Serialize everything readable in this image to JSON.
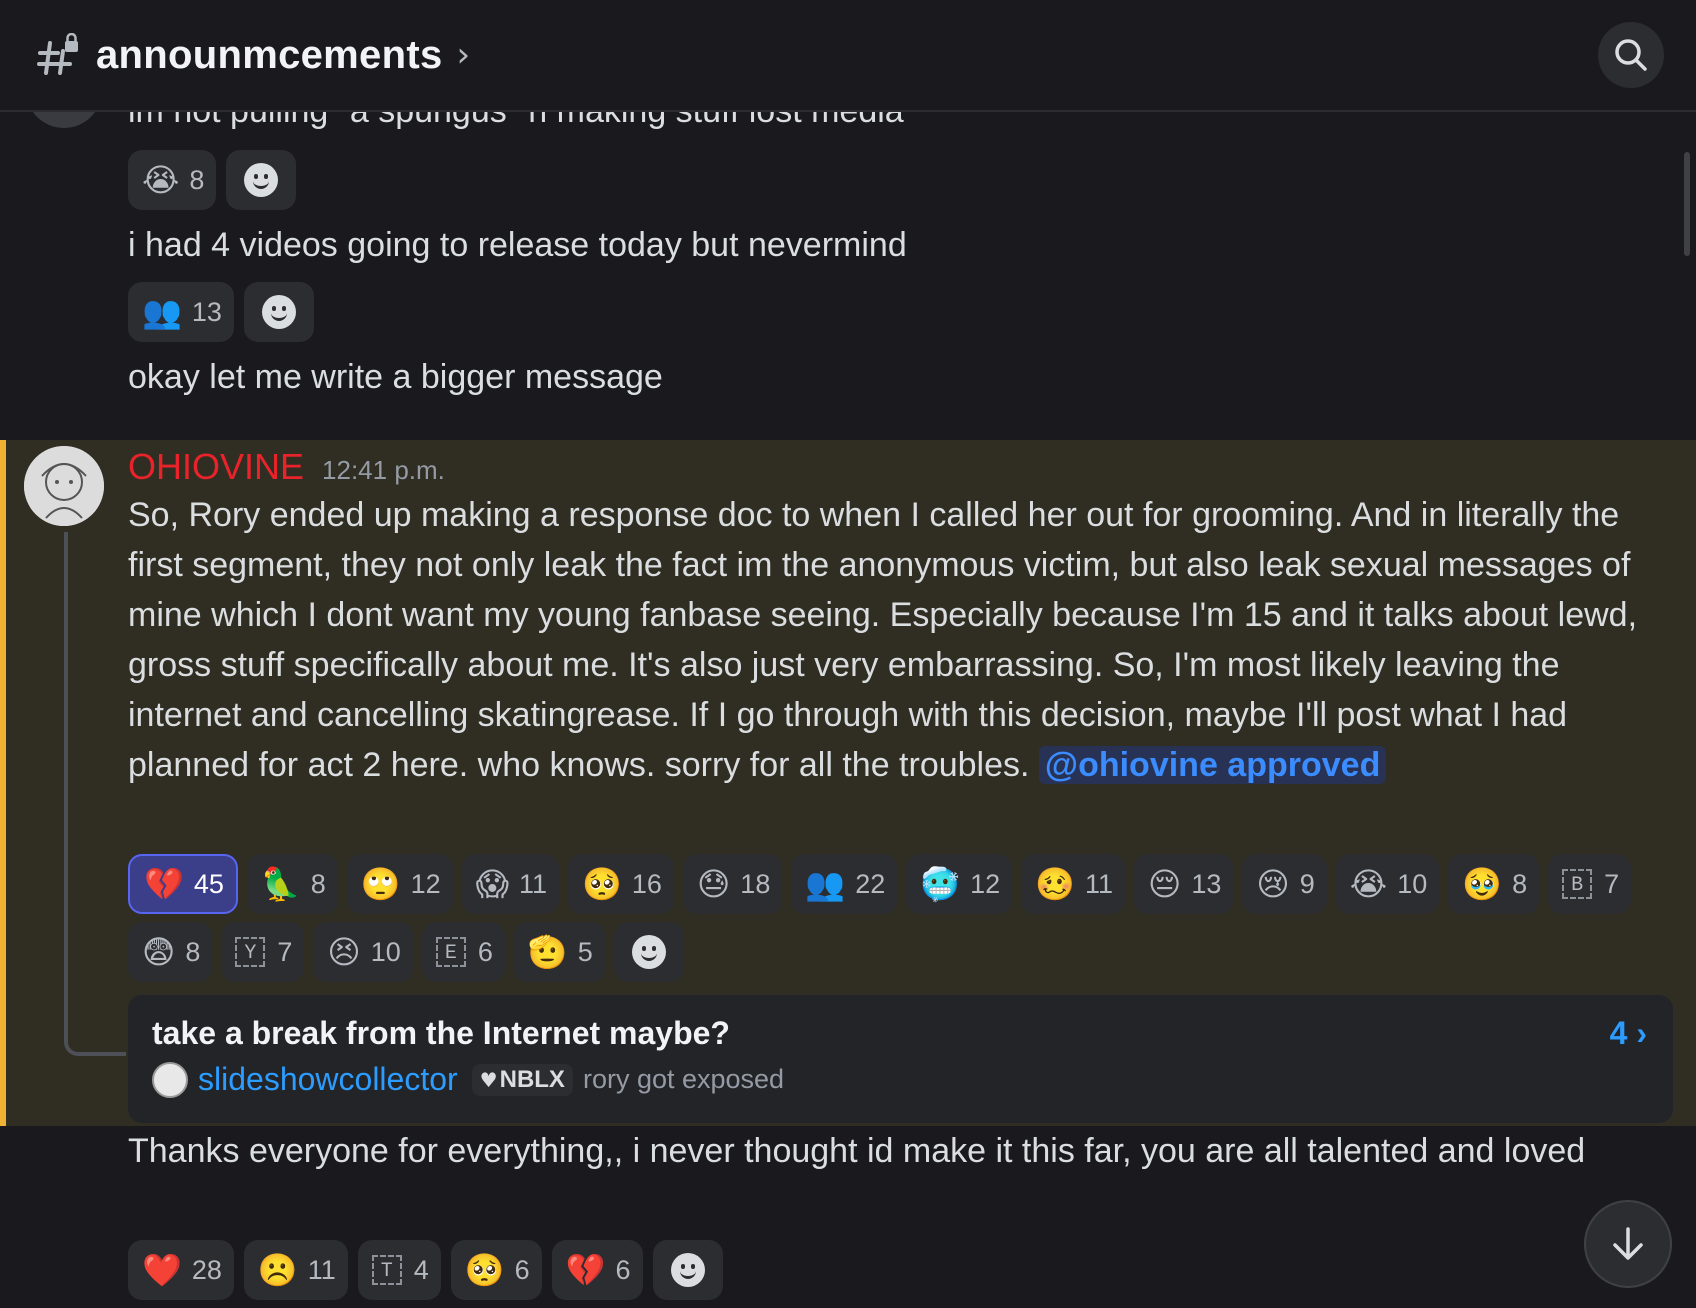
{
  "header": {
    "channel_name": "announmcements",
    "chevron": "›",
    "hash_icon": "hashtag-lock-icon",
    "search_icon": "search-icon"
  },
  "messages": [
    {
      "text": "im not pulling \"a spungus\" n making stuff lost media"
    },
    {
      "text": "i had 4 videos going to release today but nevermind"
    },
    {
      "text": "okay let me write a bigger message"
    }
  ],
  "reactions_1": [
    {
      "emoji": "😭",
      "count": "8"
    }
  ],
  "reactions_2": [
    {
      "emoji": "👥",
      "count": "13"
    }
  ],
  "highlighted_message": {
    "author": "OHIOVINE",
    "author_color": "#e8232a",
    "timestamp": "12:41 p.m.",
    "text": "So, Rory ended up making a response doc to when I called her out for grooming. And in literally the first segment, they not only leak the fact im the anonymous victim, but also leak sexual messages of mine which I dont want my young fanbase seeing. Especially because I'm 15 and it talks about lewd, gross stuff specifically about me. It's also just very embarrassing. So, I'm most likely leaving the internet and cancelling skatingrease. If I go through with this decision, maybe I'll post what I had planned for act 2 here. who knows. sorry for all the troubles. ",
    "mention": "@ohiovine approved",
    "highlight_color": "#f0b232"
  },
  "reactions_main": [
    {
      "emoji": "💔",
      "count": "45",
      "me": true
    },
    {
      "emoji": "🦜",
      "count": "8"
    },
    {
      "emoji": "🙄",
      "count": "12"
    },
    {
      "emoji": "😱",
      "count": "11"
    },
    {
      "emoji": "🥺",
      "count": "16"
    },
    {
      "emoji": "😓",
      "count": "18"
    },
    {
      "emoji": "👥",
      "count": "22"
    },
    {
      "emoji": "🥶",
      "count": "12"
    },
    {
      "emoji": "🥴",
      "count": "11"
    },
    {
      "emoji": "😔",
      "count": "13"
    },
    {
      "emoji": "😢",
      "count": "9"
    },
    {
      "emoji": "😭",
      "count": "10"
    },
    {
      "emoji": "🥹",
      "count": "8"
    },
    {
      "letter": "B",
      "count": "7"
    },
    {
      "emoji": "😨",
      "count": "8"
    },
    {
      "letter": "Y",
      "count": "7"
    },
    {
      "emoji": "😣",
      "count": "10"
    },
    {
      "letter": "E",
      "count": "6"
    },
    {
      "emoji": "🫡",
      "count": "5"
    }
  ],
  "thread": {
    "title": "take a break from the Internet maybe?",
    "count": "4 ›",
    "user": "slideshowcollector",
    "tag_heart": "♥",
    "tag": "NBLX",
    "last_message": "rory got exposed"
  },
  "last_message": {
    "text": "Thanks everyone for everything,, i never thought id make it this far, you are all talented and loved"
  },
  "reactions_last": [
    {
      "emoji": "❤️",
      "count": "28"
    },
    {
      "emoji": "☹️",
      "count": "11"
    },
    {
      "letter": "T",
      "count": "4"
    },
    {
      "emoji": "🥺",
      "count": "6"
    },
    {
      "emoji": "💔",
      "count": "6"
    }
  ]
}
